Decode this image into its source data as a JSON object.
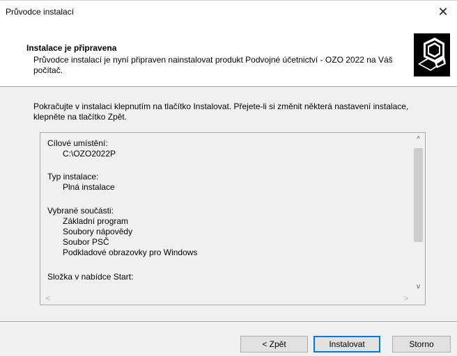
{
  "window": {
    "title": "Průvodce instalací",
    "close_symbol": "✕"
  },
  "header": {
    "title": "Instalace je připravena",
    "description": "Průvodce instalací je nyní připraven nainstalovat produkt Podvojné účetnictví - OZO 2022 na Váš počítač.",
    "icon": "installer-computer-icon"
  },
  "intro_text": "Pokračujte v instalaci klepnutím na tlačítko Instalovat. Přejete-li si změnit některá nastavení instalace, klepněte na tlačítko Zpět.",
  "summary": {
    "lines": [
      "Cílové umístění:",
      "C:\\OZO2022P",
      "Typ instalace:",
      "Plná instalace",
      "Vybrané součásti:",
      "Základní program",
      "Soubory nápovědy",
      "Soubor PSČ",
      "Podkladové obrazovky pro Windows",
      "Složka v nabídce Start:"
    ],
    "scroll_up": "^",
    "scroll_down": "v",
    "scroll_left": "<",
    "scroll_right": ">"
  },
  "buttons": {
    "back": "< Zpět",
    "install": "Instalovat",
    "cancel": "Storno"
  }
}
